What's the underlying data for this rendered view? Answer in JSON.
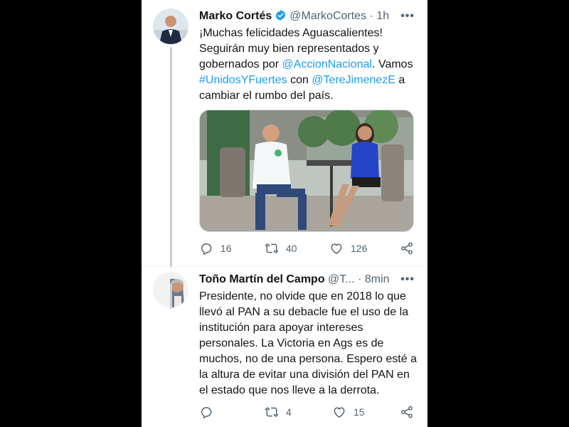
{
  "tweets": [
    {
      "name": "Marko Cortés",
      "handle": "@MarkoCortes",
      "dot": "·",
      "time": "1h",
      "more": "•••",
      "text": {
        "p1": "¡Muchas felicidades Aguascalientes! Seguirán muy bien representados y gobernados por ",
        "mention1": "@AccionNacional",
        "p2": ". Vamos ",
        "hashtag": "#UnidosYFuertes",
        "p3": " con ",
        "mention2": "@TereJimenezE",
        "p4": " a cambiar el rumbo del país."
      },
      "actions": {
        "replies": "16",
        "retweets": "40",
        "likes": "126"
      }
    },
    {
      "name": "Toño Martín del Campo",
      "handle": "@T...",
      "dot": "·",
      "time": "8min",
      "more": "•••",
      "text": "Presidente, no olvide que en 2018 lo que llevó al PAN a su debacle fue el uso de la institución para apoyar intereses personales. La Victoria en Ags es de muchos, no de una persona. Espero esté a la altura de evitar una división del PAN en el estado que nos lleve a la derrota.",
      "actions": {
        "replies": "",
        "retweets": "4",
        "likes": "15"
      }
    }
  ],
  "colors": {
    "link": "#1d9bf0",
    "verified": "#1d9bf0",
    "muted": "#536471"
  },
  "icons": [
    "verified-badge-icon",
    "reply-icon",
    "retweet-icon",
    "like-icon",
    "share-icon",
    "more-icon"
  ]
}
